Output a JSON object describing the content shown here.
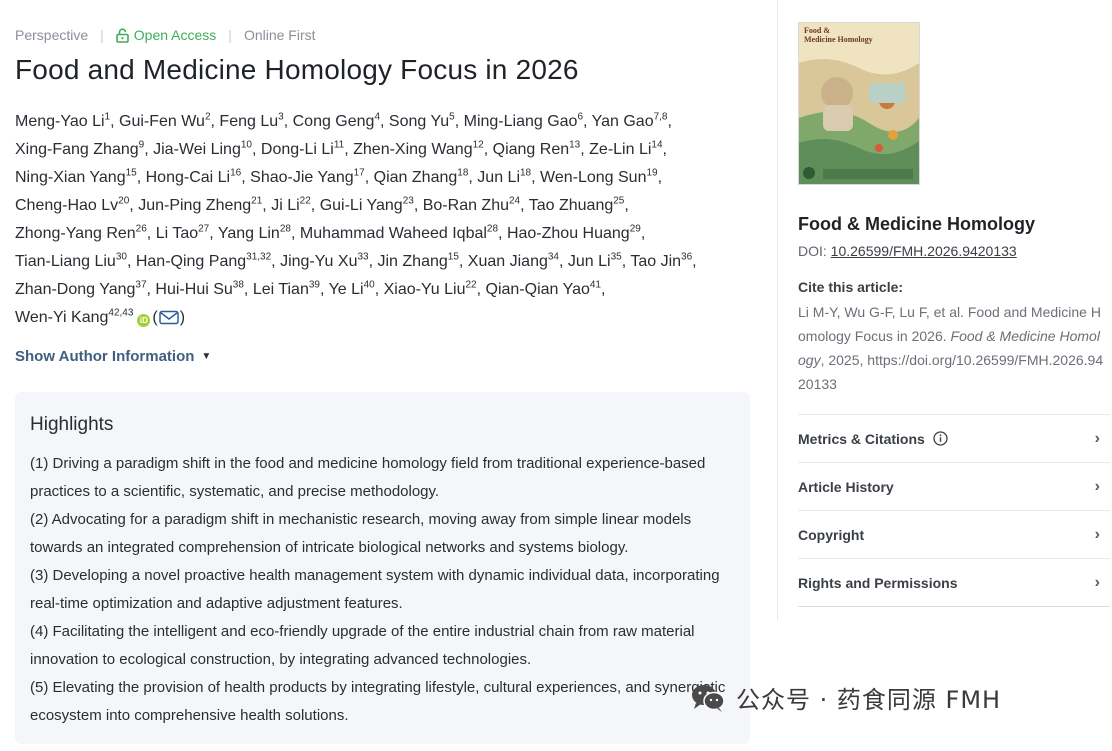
{
  "meta": {
    "article_type": "Perspective",
    "access": "Open Access",
    "status": "Online First"
  },
  "title": "Food and Medicine Homology Focus in 2026",
  "authors": [
    {
      "name": "Meng-Yao Li",
      "sup": "1"
    },
    {
      "name": "Gui-Fen Wu",
      "sup": "2"
    },
    {
      "name": "Feng Lu",
      "sup": "3"
    },
    {
      "name": "Cong Geng",
      "sup": "4"
    },
    {
      "name": "Song Yu",
      "sup": "5"
    },
    {
      "name": "Ming-Liang Gao",
      "sup": "6"
    },
    {
      "name": "Yan Gao",
      "sup": "7,8"
    },
    {
      "name": "Xing-Fang Zhang",
      "sup": "9"
    },
    {
      "name": "Jia-Wei Ling",
      "sup": "10"
    },
    {
      "name": "Dong-Li Li",
      "sup": "11"
    },
    {
      "name": "Zhen-Xing Wang",
      "sup": "12"
    },
    {
      "name": "Qiang Ren",
      "sup": "13"
    },
    {
      "name": "Ze-Lin Li",
      "sup": "14"
    },
    {
      "name": "Ning-Xian Yang",
      "sup": "15"
    },
    {
      "name": "Hong-Cai Li",
      "sup": "16"
    },
    {
      "name": "Shao-Jie Yang",
      "sup": "17"
    },
    {
      "name": "Qian Zhang",
      "sup": "18"
    },
    {
      "name": "Jun Li",
      "sup": "18"
    },
    {
      "name": "Wen-Long Sun",
      "sup": "19"
    },
    {
      "name": "Cheng-Hao Lv",
      "sup": "20"
    },
    {
      "name": "Jun-Ping Zheng",
      "sup": "21"
    },
    {
      "name": "Ji Li",
      "sup": "22"
    },
    {
      "name": "Gui-Li Yang",
      "sup": "23"
    },
    {
      "name": "Bo-Ran Zhu",
      "sup": "24"
    },
    {
      "name": "Tao Zhuang",
      "sup": "25"
    },
    {
      "name": "Zhong-Yang Ren",
      "sup": "26"
    },
    {
      "name": "Li Tao",
      "sup": "27"
    },
    {
      "name": "Yang Lin",
      "sup": "28"
    },
    {
      "name": "Muhammad Waheed Iqbal",
      "sup": "28"
    },
    {
      "name": "Hao-Zhou Huang",
      "sup": "29"
    },
    {
      "name": "Tian-Liang Liu",
      "sup": "30"
    },
    {
      "name": "Han-Qing Pang",
      "sup": "31,32"
    },
    {
      "name": "Jing-Yu Xu",
      "sup": "33"
    },
    {
      "name": "Jin Zhang",
      "sup": "15"
    },
    {
      "name": "Xuan Jiang",
      "sup": "34"
    },
    {
      "name": "Jun Li",
      "sup": "35"
    },
    {
      "name": "Tao Jin",
      "sup": "36"
    },
    {
      "name": "Zhan-Dong Yang",
      "sup": "37"
    },
    {
      "name": "Hui-Hui Su",
      "sup": "38"
    },
    {
      "name": "Lei Tian",
      "sup": "39"
    },
    {
      "name": "Ye Li",
      "sup": "40"
    },
    {
      "name": "Xiao-Yu Liu",
      "sup": "22"
    },
    {
      "name": "Qian-Qian Yao",
      "sup": "41"
    },
    {
      "name": "Wen-Yi Kang",
      "sup": "42,43",
      "corresponding": true
    }
  ],
  "orcid_badge": "iD",
  "show_author_label": "Show Author Information",
  "highlights": {
    "heading": "Highlights",
    "items": [
      "(1) Driving a paradigm shift in the food and medicine homology field from traditional experience-based practices to a scientific, systematic, and precise methodology.",
      "(2) Advocating for a paradigm shift in mechanistic research, moving away from simple linear models towards an integrated comprehension of intricate biological networks and systems biology.",
      "(3) Developing a novel proactive health management system with dynamic individual data, incorporating real-time optimization and adaptive adjustment features.",
      "(4) Facilitating the intelligent and eco-friendly upgrade of the entire industrial chain from raw material innovation to ecological construction, by integrating advanced technologies.",
      "(5) Elevating the provision of health products by integrating lifestyle, cultural experiences, and synergistic ecosystem into comprehensive health solutions."
    ]
  },
  "sidebar": {
    "cover_title": "Food &\nMedicine Homology",
    "journal": "Food & Medicine Homology",
    "doi_label": "DOI:",
    "doi": "10.26599/FMH.2026.9420133",
    "cite_label": "Cite this article:",
    "cite_pre": "Li M-Y, Wu G-F, Lu F, et al. Food and Medicine Homology Focus in 2026. ",
    "cite_journal": "Food & Medicine Homology",
    "cite_post": ", 2025, https://doi.org/10.26599/FMH.2026.9420133",
    "accordion": [
      {
        "label": "Metrics & Citations",
        "info": true
      },
      {
        "label": "Article History"
      },
      {
        "label": "Copyright"
      },
      {
        "label": "Rights and Permissions"
      }
    ]
  },
  "watermark": "公众号 · 药食同源 FMH",
  "colors": {
    "accent_link": "#3f5f80",
    "open_access": "#3fae56",
    "highlight_bg": "#f4f6f9",
    "orcid": "#a6ce39"
  }
}
